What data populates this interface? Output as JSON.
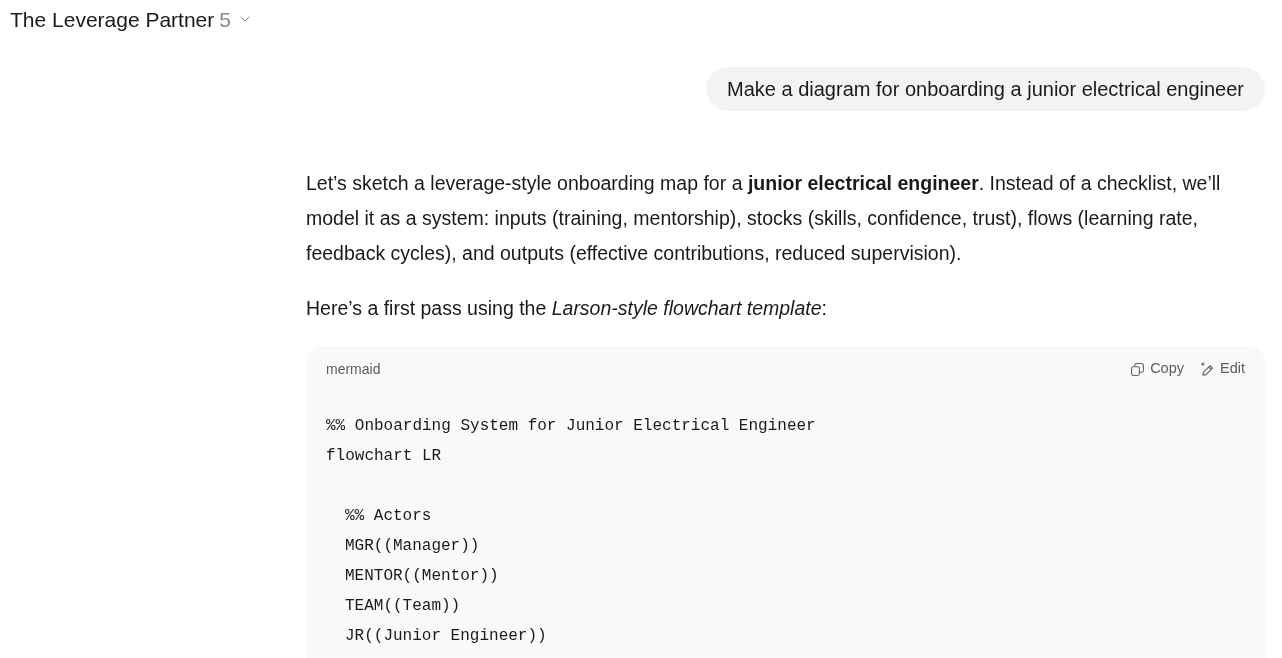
{
  "header": {
    "title": "The Leverage Partner",
    "count": "5"
  },
  "user_message": {
    "text": "Make a diagram for onboarding a junior electrical engineer"
  },
  "response": {
    "paragraphs": [
      "Let’s sketch a leverage-style onboarding map for a **junior electrical engineer**. Instead of a checklist, we’ll model it as a system: inputs (training, mentorship), stocks (skills, confidence, trust), flows (learning rate, feedback cycles), and outputs (effective contributions, reduced supervision).",
      "Here’s a first pass using the *Larson-style flowchart template*:"
    ],
    "code_block": {
      "language": "mermaid",
      "actions": [
        {
          "kind": "copy",
          "label": "Copy"
        },
        {
          "kind": "edit",
          "label": "Edit"
        }
      ],
      "blocks": [
        {
          "indented": false,
          "lines": [
            "%% Onboarding System for Junior Electrical Engineer",
            "flowchart LR"
          ]
        },
        {
          "indented": true,
          "lines": [
            "%% Actors",
            "MGR((Manager))",
            "MENTOR((Mentor))",
            "TEAM((Team))",
            "JR((Junior Engineer))"
          ]
        }
      ]
    }
  }
}
